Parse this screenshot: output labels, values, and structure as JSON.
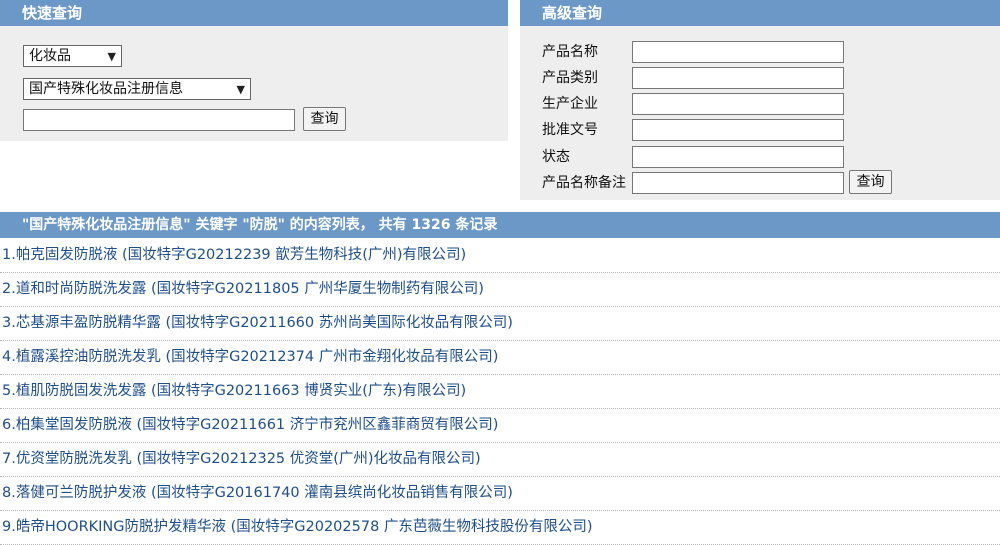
{
  "quick_search": {
    "title": "快速查询",
    "category_select": "化妆品",
    "database_select": "国产特殊化妆品注册信息",
    "keyword_value": "",
    "search_button": "查询"
  },
  "advanced_search": {
    "title": "高级查询",
    "fields": [
      {
        "label": "产品名称",
        "value": ""
      },
      {
        "label": "产品类别",
        "value": ""
      },
      {
        "label": "生产企业",
        "value": ""
      },
      {
        "label": "批准文号",
        "value": ""
      },
      {
        "label": "状态",
        "value": ""
      },
      {
        "label": "产品名称备注",
        "value": ""
      }
    ],
    "search_button": "查询"
  },
  "results": {
    "header": "\"国产特殊化妆品注册信息\" 关键字 \"防脱\" 的内容列表， 共有 1326 条记录",
    "items": [
      "1.帕克固发防脱液 (国妆特字G20212239 歆芳生物科技(广州)有限公司)",
      "2.道和时尚防脱洗发露 (国妆特字G20211805 广州华厦生物制药有限公司)",
      "3.芯基源丰盈防脱精华露 (国妆特字G20211660 苏州尚美国际化妆品有限公司)",
      "4.植露溪控油防脱洗发乳 (国妆特字G20212374 广州市金翔化妆品有限公司)",
      "5.植肌防脱固发洗发露 (国妆特字G20211663 博贤实业(广东)有限公司)",
      "6.柏集堂固发防脱液 (国妆特字G20211661 济宁市兖州区鑫菲商贸有限公司)",
      "7.优资堂防脱洗发乳 (国妆特字G20212325 优资堂(广州)化妆品有限公司)",
      "8.落健可兰防脱护发液 (国妆特字G20161740 灌南县缤尚化妆品销售有限公司)",
      "9.皓帝HOORKING防脱护发精华液 (国妆特字G20202578 广东芭薇生物科技股份有限公司)"
    ]
  },
  "colors": {
    "header_bg": "#6c98c8",
    "panel_bg": "#eeeeee",
    "link": "#1f4f8a"
  }
}
